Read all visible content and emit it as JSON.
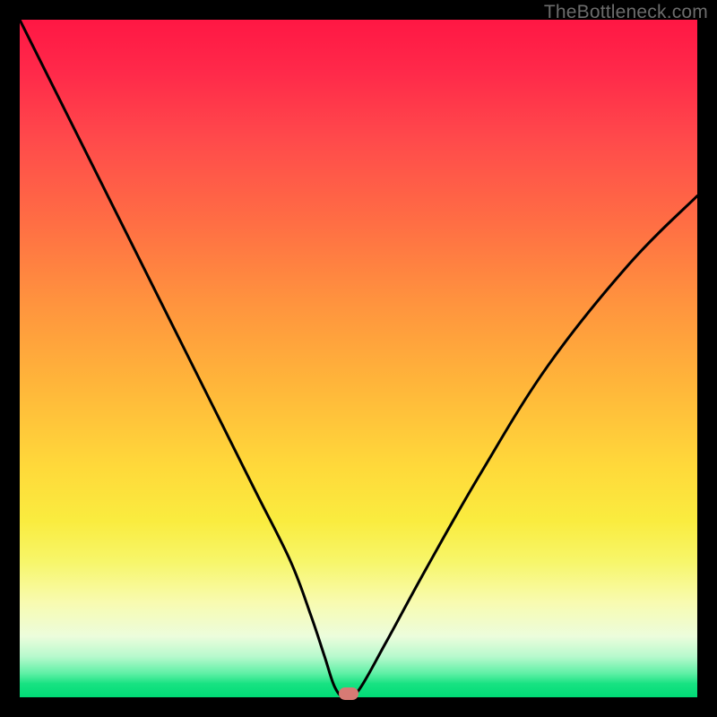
{
  "watermark": "TheBottleneck.com",
  "chart_data": {
    "type": "line",
    "title": "",
    "xlabel": "",
    "ylabel": "",
    "xlim": [
      0,
      100
    ],
    "ylim": [
      0,
      100
    ],
    "grid": false,
    "legend": false,
    "series": [
      {
        "name": "curve",
        "x": [
          0,
          6,
          12,
          18,
          24,
          30,
          35,
          40,
          43,
          45,
          46.5,
          48,
          50,
          54,
          60,
          68,
          78,
          90,
          100
        ],
        "y": [
          100,
          88,
          76,
          64,
          52,
          40,
          30,
          20,
          12,
          6,
          1.5,
          0,
          1,
          8,
          19,
          33,
          49,
          64,
          74
        ]
      }
    ],
    "marker": {
      "x": 48.5,
      "y": 0.5,
      "color": "#d77a74"
    },
    "background_gradient": {
      "top": "#ff1744",
      "mid": "#ffd93a",
      "bottom": "#00db76"
    }
  }
}
